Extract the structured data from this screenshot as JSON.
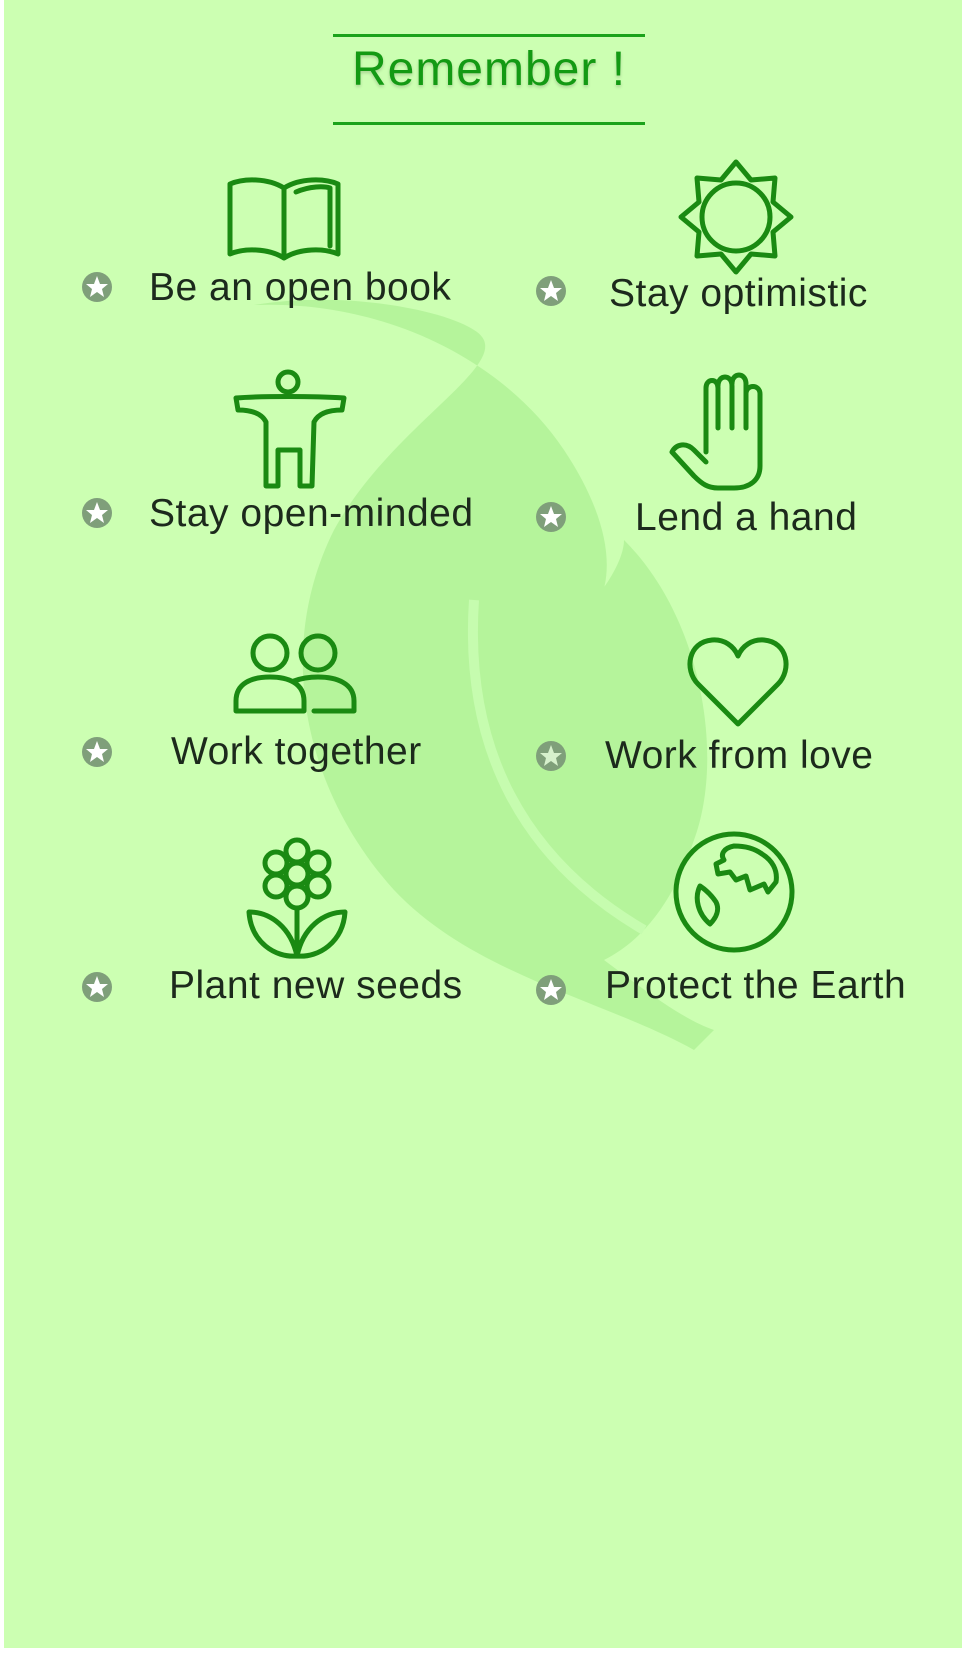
{
  "title": "Remember !",
  "accent_color": "#1a8a12",
  "background_color": "#ccffb2",
  "items": [
    {
      "label": "Be an open book",
      "icon": "open-book-icon"
    },
    {
      "label": "Stay optimistic",
      "icon": "sun-icon"
    },
    {
      "label": "Stay open-minded",
      "icon": "person-open-arms-icon"
    },
    {
      "label": "Lend a hand",
      "icon": "hand-icon"
    },
    {
      "label": "Work together",
      "icon": "two-people-icon"
    },
    {
      "label": "Work from love",
      "icon": "heart-icon"
    },
    {
      "label": "Plant new seeds",
      "icon": "flower-icon"
    },
    {
      "label": "Protect the Earth",
      "icon": "earth-icon"
    }
  ],
  "bullet_icon": "star-bullet-icon"
}
